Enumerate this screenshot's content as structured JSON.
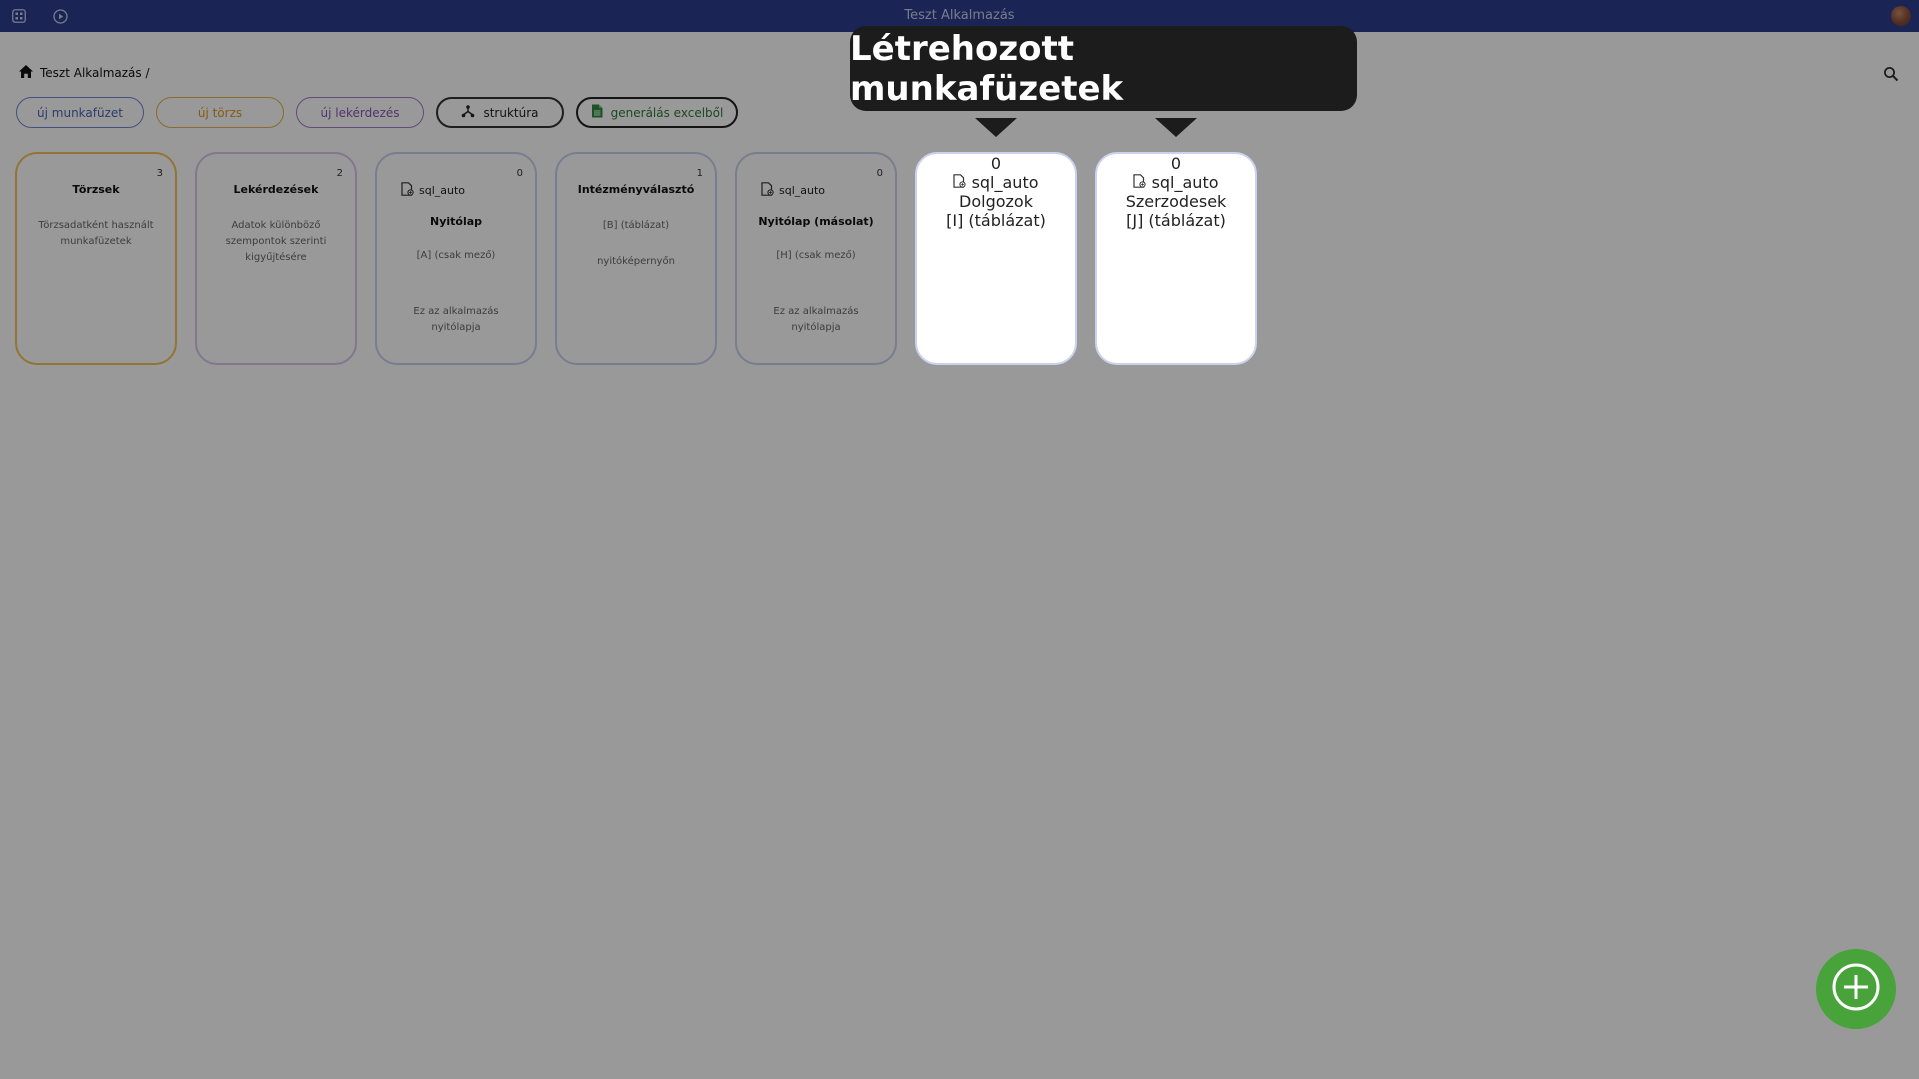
{
  "app": {
    "title": "Teszt Alkalmazás"
  },
  "breadcrumb": {
    "label": "Teszt Alkalmazás /"
  },
  "toolbar": {
    "new_workbook": "új munkafüzet",
    "new_master": "új törzs",
    "new_query": "új lekérdezés",
    "structure": "struktúra",
    "generate_excel": "generálás excelből"
  },
  "cards": [
    {
      "title": "Törzsek",
      "count": "3",
      "kind": "",
      "sub1": "Törzsadatként használt munkafüzetek",
      "sub2": ""
    },
    {
      "title": "Lekérdezések",
      "count": "2",
      "kind": "",
      "sub1": "Adatok különböző szempontok szerinti kigyűjtésére",
      "sub2": ""
    },
    {
      "title": "Nyitólap",
      "count": "0",
      "kind": "sql_auto",
      "sub1": "[A] (csak mező)",
      "sub2": "Ez az alkalmazás nyitólapja"
    },
    {
      "title": "Intézményválasztó",
      "count": "1",
      "kind": "",
      "sub1": "[B] (táblázat)",
      "sub2": "nyitóképernyőn"
    },
    {
      "title": "Nyitólap (másolat)",
      "count": "0",
      "kind": "sql_auto",
      "sub1": "[H] (csak mező)",
      "sub2": "Ez az alkalmazás nyitólapja"
    },
    {
      "title": "Dolgozok",
      "count": "0",
      "kind": "sql_auto",
      "sub1": "[I] (táblázat)",
      "sub2": ""
    },
    {
      "title": "Szerzodesek",
      "count": "0",
      "kind": "sql_auto",
      "sub1": "[J] (táblázat)",
      "sub2": ""
    }
  ],
  "tooltip": {
    "text": "Létrehozott munkafüzetek"
  },
  "icons": {
    "grid": "grid-icon",
    "play": "play-circle-icon",
    "home": "home-icon",
    "search": "search-icon",
    "structure": "hierarchy-icon",
    "excel": "spreadsheet-file-icon",
    "sql": "sql-file-icon",
    "add": "add-circle-icon"
  },
  "colors": {
    "topbar": "#2c3e8f",
    "fab": "#47a33a",
    "blue": "#4e63b6",
    "orange": "#d89a22",
    "purple": "#8a55b3",
    "green": "#2e7a3a"
  }
}
